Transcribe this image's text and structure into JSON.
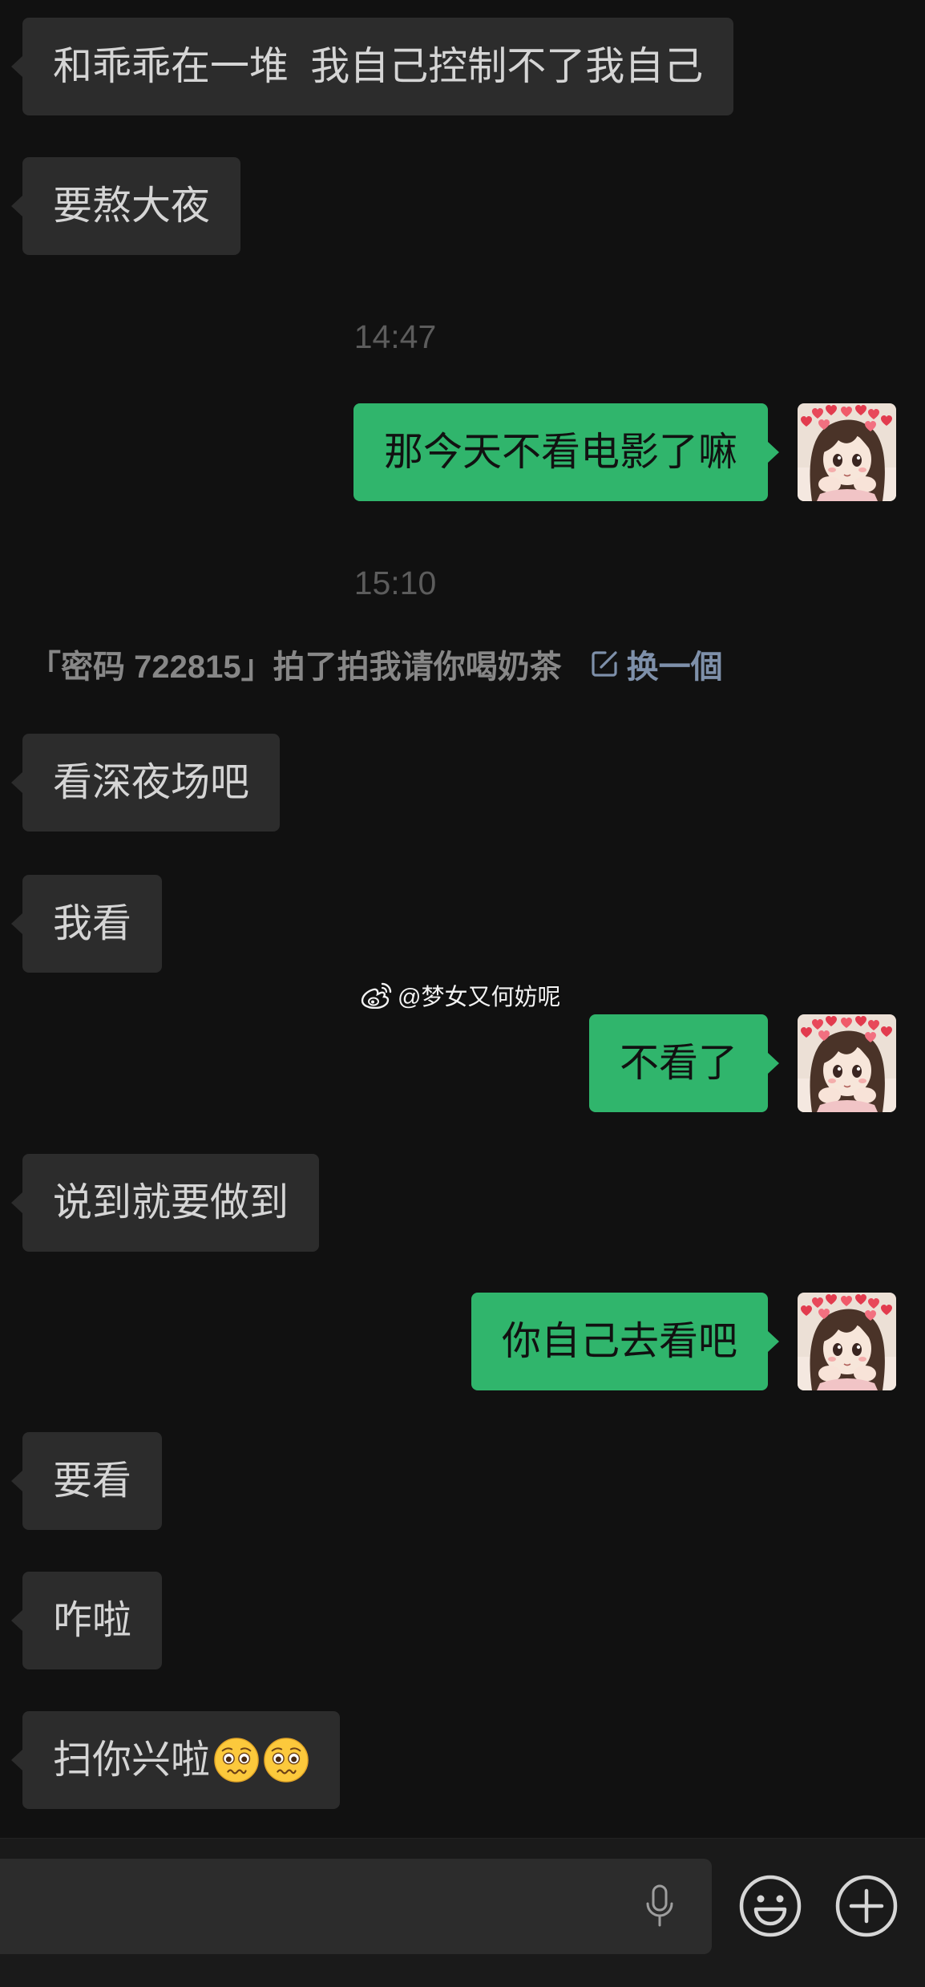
{
  "messages": [
    {
      "outgoing": false,
      "text": "和乖乖在一堆  我自己控制不了我自己"
    },
    {
      "outgoing": false,
      "text": "要熬大夜"
    },
    {
      "outgoing": true,
      "text": "那今天不看电影了嘛"
    },
    {
      "outgoing": false,
      "text": "看深夜场吧"
    },
    {
      "outgoing": false,
      "text": "我看"
    },
    {
      "outgoing": true,
      "text": "不看了"
    },
    {
      "outgoing": false,
      "text": "说到就要做到"
    },
    {
      "outgoing": true,
      "text": "你自己去看吧"
    },
    {
      "outgoing": false,
      "text": "要看"
    },
    {
      "outgoing": false,
      "text": "咋啦"
    },
    {
      "outgoing": false,
      "text": "扫你兴啦",
      "emojis": [
        "pleading-face-emoji-icon",
        "pleading-face-emoji-icon"
      ]
    }
  ],
  "timestamps": [
    "14:47",
    "15:10"
  ],
  "pat_notice": {
    "text": "「密码 722815」拍了拍我请你喝奶茶",
    "action_icon": "edit-icon",
    "action_label": "换一個"
  },
  "watermark": {
    "icon": "weibo-logo-icon",
    "text": "@梦女又何妨呢"
  },
  "self_avatar_icon": "anime-girl-avatar",
  "input_bar": {
    "value": "",
    "icons": [
      "microphone-icon",
      "emoji-icon",
      "plus-icon"
    ]
  },
  "colors": {
    "background": "#111111",
    "received_bubble": "#2c2c2c",
    "sent_bubble": "#30b56c",
    "received_text": "#d5d5d5",
    "sent_text": "#111111",
    "timestamp": "#5c5c5c",
    "notice_text": "#878787",
    "notice_action": "#7e90aa"
  }
}
